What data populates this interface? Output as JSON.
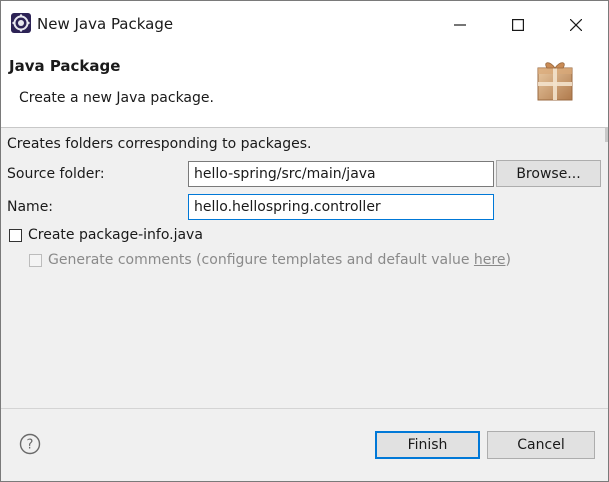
{
  "window": {
    "title": "New Java Package",
    "app_icon": "eclipse-icon",
    "controls": [
      "minimize-icon",
      "maximize-icon",
      "close-icon"
    ]
  },
  "banner": {
    "title": "Java Package",
    "description": "Create a new Java package.",
    "icon": "package-wizard-icon"
  },
  "form": {
    "info": "Creates folders corresponding to packages.",
    "source_folder": {
      "label": "Source folder:",
      "value": "hello-spring/src/main/java",
      "browse_label": "Browse..."
    },
    "name": {
      "label": "Name:",
      "value": "hello.hellospring.controller"
    },
    "create_package_info": {
      "label": "Create package-info.java",
      "checked": false
    },
    "generate_comments": {
      "label_prefix": "Generate comments (configure templates and default value ",
      "link": "here",
      "label_suffix": ")",
      "checked": false,
      "enabled": false
    }
  },
  "footer": {
    "help_icon": "help-icon",
    "finish_label": "Finish",
    "cancel_label": "Cancel"
  },
  "colors": {
    "accent": "#0078d7",
    "panel_bg": "#f0f0f0",
    "button_bg": "#e1e1e1"
  }
}
